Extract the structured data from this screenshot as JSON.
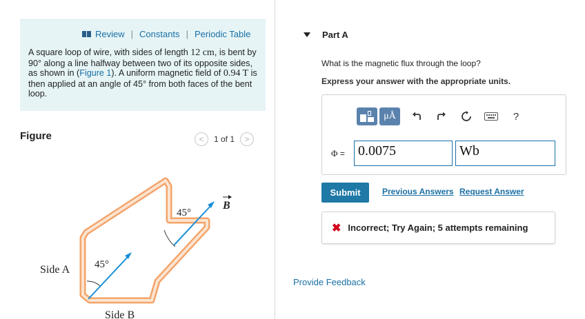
{
  "review": {
    "links": [
      "Review",
      "Constants",
      "Periodic Table"
    ],
    "problem": {
      "p1": "A square loop of wire, with sides of length ",
      "side_length": "12 cm",
      "p2": ", is bent by 90° along a line halfway between two of its opposite sides, as shown in (",
      "figure_link": "Figure 1",
      "p3": "). A uniform magnetic field of ",
      "field": "0.94 T",
      "p4": " is then applied at an angle of 45° from both faces of the bent loop."
    }
  },
  "figure": {
    "label": "Figure",
    "pager": {
      "prev": "<",
      "count": "1 of 1",
      "next": ">"
    },
    "labels": {
      "side_a": "Side A",
      "side_b": "Side B",
      "angle_top": "45°",
      "angle_left": "45°",
      "field": "B"
    },
    "colors": {
      "loop_fill": "#f4a46a",
      "loop_inner": "#fbe4d0",
      "vector": "#1a8fd8"
    }
  },
  "part_a": {
    "title": "Part A",
    "question": "What is the magnetic flux through the loop?",
    "instruction": "Express your answer with the appropriate units.",
    "toolbar": {
      "units_label": "μÅ",
      "icons": [
        "templates-icon",
        "units-icon",
        "undo-icon",
        "redo-icon",
        "reset-icon",
        "keyboard-icon",
        "help-icon"
      ],
      "help_label": "?"
    },
    "answer": {
      "label_symbol": "Φ",
      "label_eq": " =",
      "value": "0.0075",
      "unit": "Wb"
    },
    "buttons": {
      "submit": "Submit",
      "previous_answers": "Previous Answers",
      "request_answer": "Request Answer"
    },
    "feedback": "Incorrect; Try Again; 5 attempts remaining",
    "colors": {
      "accent": "#1a6fa5",
      "submit_bg": "#1f79a6",
      "error": "#d0021b",
      "toolbar_blue": "#5b82ad"
    }
  },
  "provide_feedback": "Provide Feedback"
}
